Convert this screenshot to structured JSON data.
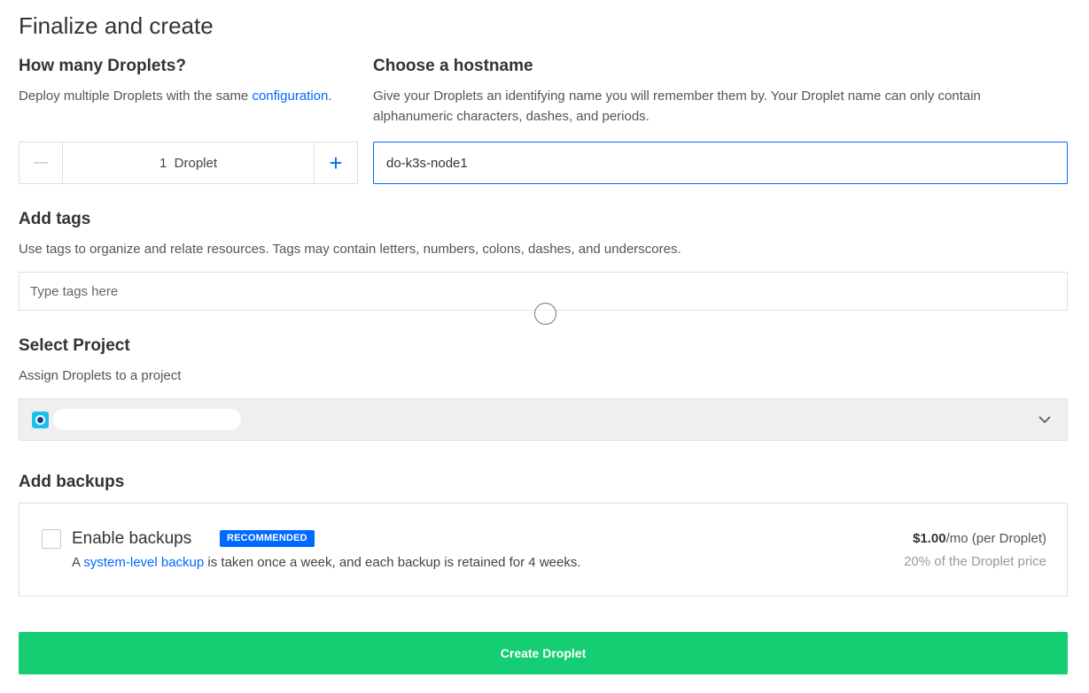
{
  "page": {
    "title": "Finalize and create"
  },
  "droplets": {
    "title": "How many Droplets?",
    "desc_prefix": "Deploy multiple Droplets with the same ",
    "desc_link": "configuration",
    "desc_suffix": ".",
    "minus_symbol": "—",
    "plus_symbol": "+",
    "count_text": "1  Droplet"
  },
  "hostname": {
    "title": "Choose a hostname",
    "desc": "Give your Droplets an identifying name you will remember them by. Your Droplet name can only contain alphanumeric characters, dashes, and periods.",
    "value": "do-k3s-node1"
  },
  "tags": {
    "title": "Add tags",
    "desc": "Use tags to organize and relate resources. Tags may contain letters, numbers, colons, dashes, and underscores.",
    "placeholder": "Type tags here"
  },
  "project": {
    "title": "Select Project",
    "desc": "Assign Droplets to a project",
    "chevron_icon": "chevron-down-icon"
  },
  "backups": {
    "title": "Add backups",
    "enable_label": "Enable backups",
    "badge": "RECOMMENDED",
    "desc_prefix": "A ",
    "desc_link": "system-level backup",
    "desc_suffix": " is taken once a week, and each backup is retained for 4 weeks.",
    "price_amount": "$1.00",
    "price_suffix": "/mo (per Droplet)",
    "price_sub": "20% of the Droplet price"
  },
  "create": {
    "label": "Create Droplet"
  },
  "colors": {
    "accent": "#0069ff",
    "create_button": "#15cd72",
    "project_icon": "#19c2e8"
  }
}
